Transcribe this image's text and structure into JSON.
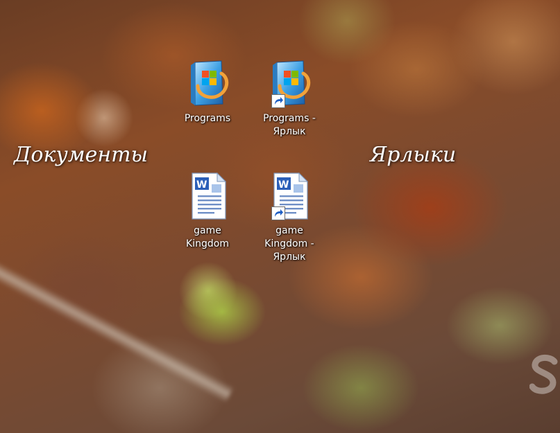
{
  "desktop": {
    "labels": {
      "documents": "Документы",
      "shortcuts": "Ярлыки"
    },
    "icons": [
      {
        "label": "Programs",
        "icon": "windows-folder-icon",
        "shortcut": false
      },
      {
        "label": "Programs - Ярлык",
        "icon": "windows-folder-icon",
        "shortcut": true
      },
      {
        "label": "game Kingdom",
        "icon": "word-document-icon",
        "shortcut": false
      },
      {
        "label": "game Kingdom - Ярлык",
        "icon": "word-document-icon",
        "shortcut": true
      }
    ],
    "watermark_icon": "corner-watermark",
    "colors": {
      "label_text": "#ffffff",
      "folder_blue": "#2e8fd6",
      "folder_orange": "#f2a23a",
      "doc_blue": "#2b5fb8"
    }
  }
}
